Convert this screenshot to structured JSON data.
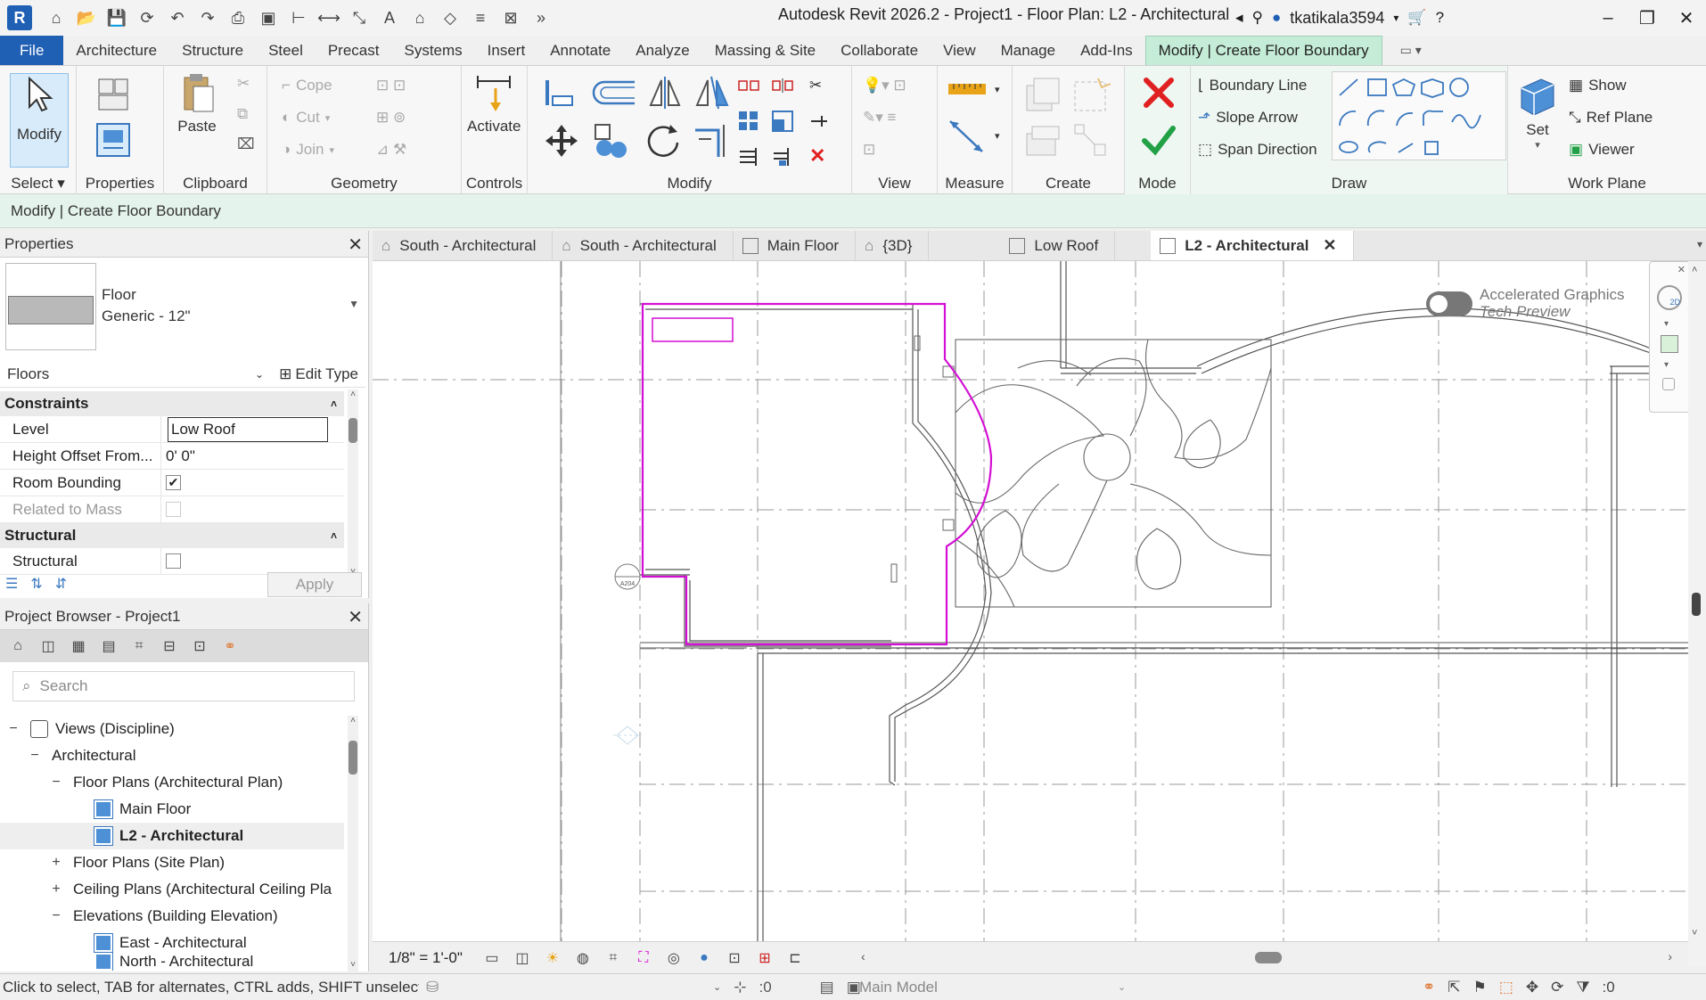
{
  "app": {
    "title": "Autodesk Revit 2026.2 - Project1 - Floor Plan: L2 - Architectural",
    "user": "tkatikala3594",
    "logo_letter": "R"
  },
  "ribbon_tabs": [
    "File",
    "Architecture",
    "Structure",
    "Steel",
    "Precast",
    "Systems",
    "Insert",
    "Annotate",
    "Analyze",
    "Massing & Site",
    "Collaborate",
    "View",
    "Manage",
    "Add-Ins",
    "Modify | Create Floor Boundary"
  ],
  "ribbon": {
    "select_label": "Select",
    "modify_label": "Modify",
    "properties_label": "Properties",
    "paste_label": "Paste",
    "clipboard_label": "Clipboard",
    "cope_label": "Cope",
    "cut_label": "Cut",
    "join_label": "Join",
    "geometry_label": "Geometry",
    "activate_label": "Activate",
    "controls_label": "Controls",
    "modify_group_label": "Modify",
    "view_label": "View",
    "measure_label": "Measure",
    "create_label": "Create",
    "mode_label": "Mode",
    "boundary_line": "Boundary Line",
    "slope_arrow": "Slope Arrow",
    "span_direction": "Span Direction",
    "draw_label": "Draw",
    "set_label": "Set",
    "show_label": "Show",
    "ref_plane_label": "Ref  Plane",
    "viewer_label": "Viewer",
    "work_plane_label": "Work Plane"
  },
  "context_bar": "Modify | Create Floor Boundary",
  "properties": {
    "header": "Properties",
    "type_name": "Floor",
    "type_sub": "Generic - 12\"",
    "category": "Floors",
    "edit_type": "Edit Type",
    "sections": [
      {
        "name": "Constraints",
        "rows": [
          {
            "label": "Level",
            "value": "Low Roof"
          },
          {
            "label": "Height Offset From...",
            "value": "0'  0\""
          },
          {
            "label": "Room Bounding",
            "checked": true
          },
          {
            "label": "Related to Mass",
            "checked": false
          }
        ]
      },
      {
        "name": "Structural",
        "rows": [
          {
            "label": "Structural",
            "checked": false
          }
        ]
      }
    ],
    "apply": "Apply"
  },
  "project_browser": {
    "header": "Project Browser - Project1",
    "search_placeholder": "Search",
    "tree": [
      {
        "label": "Views (Discipline)",
        "glyph": "−"
      },
      {
        "label": "Architectural",
        "glyph": "−"
      },
      {
        "label": "Floor Plans (Architectural Plan)",
        "glyph": "−"
      },
      {
        "label": "Main Floor"
      },
      {
        "label": "L2 - Architectural",
        "selected": true
      },
      {
        "label": "Floor Plans (Site Plan)",
        "glyph": "+"
      },
      {
        "label": "Ceiling Plans (Architectural Ceiling Pla",
        "glyph": "+"
      },
      {
        "label": "Elevations (Building Elevation)",
        "glyph": "−"
      },
      {
        "label": "East - Architectural"
      },
      {
        "label": "North - Architectural"
      }
    ]
  },
  "view_tabs": [
    {
      "label": "South - Architectural",
      "icon": "elevation-icon"
    },
    {
      "label": "South - Architectural",
      "icon": "elevation-icon"
    },
    {
      "label": "Main Floor",
      "icon": "plan-icon"
    },
    {
      "label": "{3D}",
      "icon": "3d-house-icon"
    },
    {
      "label": "Low Roof",
      "icon": "plan-icon"
    },
    {
      "label": "L2 - Architectural",
      "icon": "plan-icon",
      "active": true
    }
  ],
  "canvas": {
    "accelerated_graphics": "Accelerated Graphics",
    "tech_preview": "Tech Preview",
    "section_tag": "A204",
    "boundary_color": "#d40fd4"
  },
  "view_control": {
    "scale": "1/8\" = 1'-0\""
  },
  "status": {
    "message": "Click to select, TAB for alternates, CTRL adds, SHIFT unselect",
    "workset_count": ":0",
    "model": "Main Model",
    "filter_count": ":0"
  },
  "colors": {
    "accent": "#1f5fb4",
    "context_tab": "#c5ecd7",
    "finish_green": "#22a046",
    "cancel_red": "#e02020"
  }
}
